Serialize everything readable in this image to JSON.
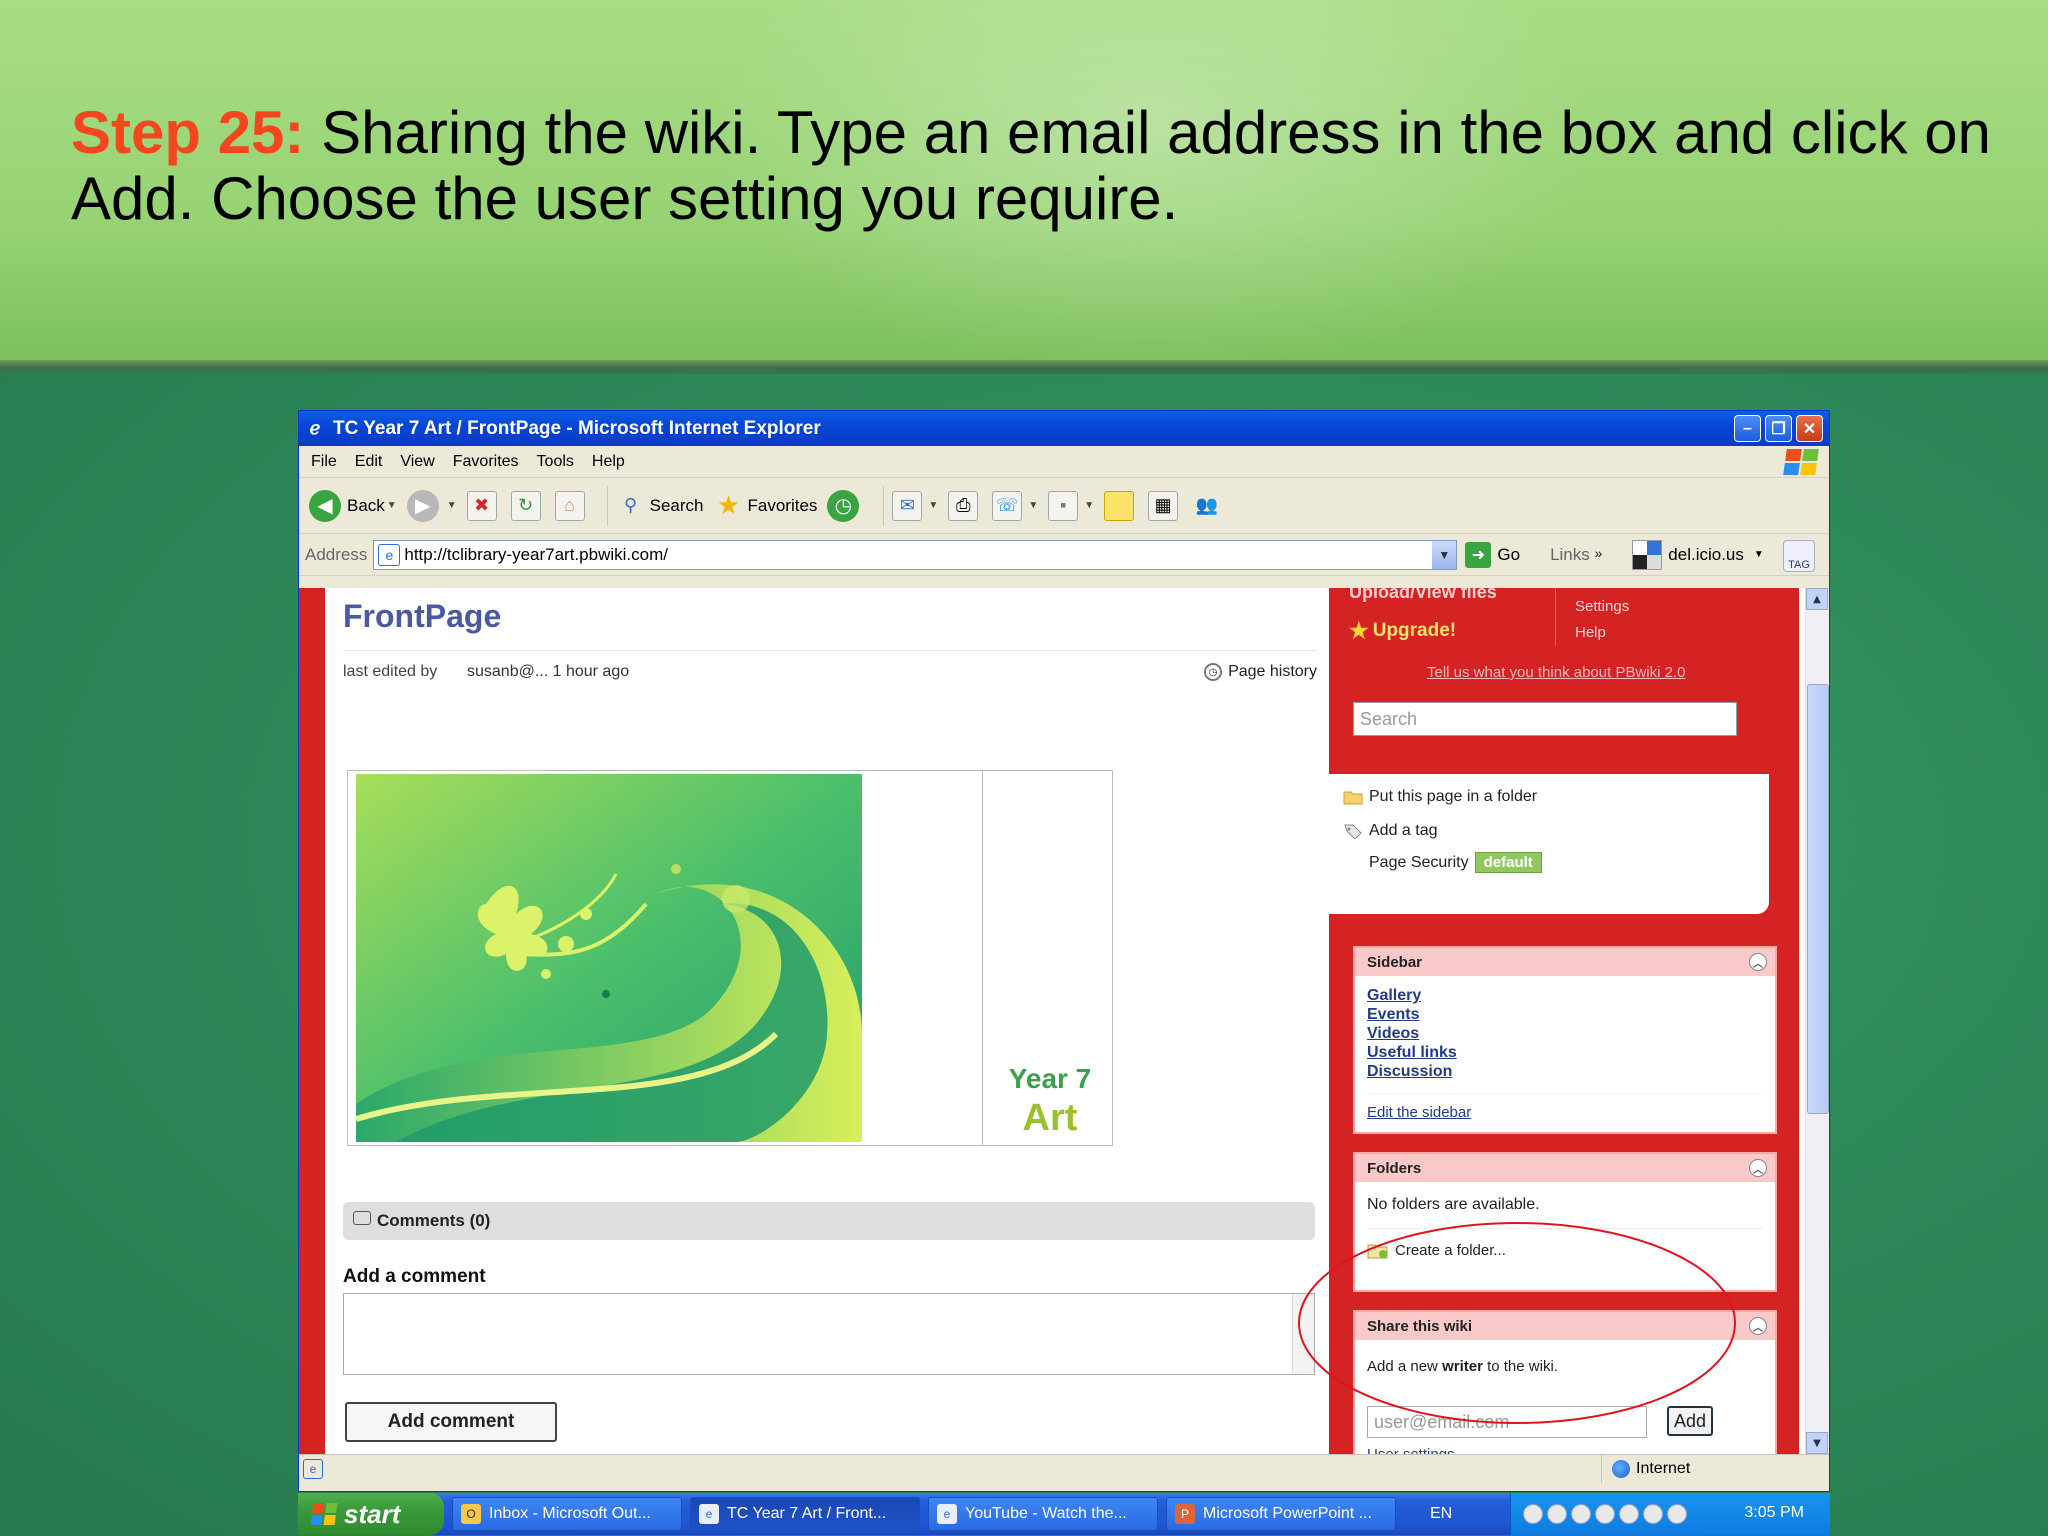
{
  "slide": {
    "step_label": "Step 25:",
    "instruction": " Sharing the wiki. Type an email address in the box and click on Add. Choose the user setting you require."
  },
  "window": {
    "title": "TC Year 7 Art / FrontPage - Microsoft Internet Explorer",
    "menu": [
      "File",
      "Edit",
      "View",
      "Favorites",
      "Tools",
      "Help"
    ],
    "toolbar": {
      "back": "Back",
      "search": "Search",
      "favorites": "Favorites"
    },
    "address_label": "Address",
    "address_url": "http://tclibrary-year7art.pbwiki.com/",
    "go_label": "Go",
    "links_label": "Links",
    "delicious_label": "del.icio.us",
    "tag_label": "TAG"
  },
  "page": {
    "title": "FrontPage",
    "last_edited_label": "last edited by",
    "last_edited_by": "susanb@... 1 hour ago",
    "page_history": "Page history",
    "banner_year": "Year 7",
    "banner_subject": "Art",
    "comments_header": "Comments (0)",
    "add_comment_label": "Add a comment",
    "add_comment_button": "Add comment"
  },
  "wiki_sidebar": {
    "upload": "Upload/View files",
    "upgrade": "Upgrade!",
    "settings": "Settings",
    "help": "Help",
    "feedback": "Tell us what you think about PBwiki 2.0",
    "search_placeholder": "Search",
    "page_options": {
      "put_in_folder": "Put this page in a folder",
      "add_tag": "Add a tag",
      "page_security": "Page Security",
      "security_badge": "default"
    },
    "sidebar_panel": {
      "title": "Sidebar",
      "links": [
        "Gallery",
        "Events",
        "Videos",
        "Useful links",
        "Discussion"
      ],
      "edit_link": "Edit the sidebar"
    },
    "folders_panel": {
      "title": "Folders",
      "empty_text": "No folders are available.",
      "create_link": "Create a folder..."
    },
    "share_panel": {
      "title": "Share this wiki",
      "text_prefix": "Add a new ",
      "text_bold": "writer",
      "text_suffix": " to the wiki.",
      "email_placeholder": "user@email.com",
      "add_button": "Add",
      "user_settings": "User settings"
    }
  },
  "statusbar": {
    "zone": "Internet"
  },
  "taskbar": {
    "start": "start",
    "tasks": [
      "Inbox - Microsoft Out...",
      "TC Year 7 Art / Front...",
      "YouTube - Watch the...",
      "Microsoft PowerPoint ..."
    ],
    "language": "EN",
    "clock": "3:05 PM"
  },
  "colors": {
    "step_accent": "#f5461d",
    "wiki_red": "#d52222",
    "xp_blue": "#0a5fe8",
    "annotation_circle": "#e0141e"
  }
}
